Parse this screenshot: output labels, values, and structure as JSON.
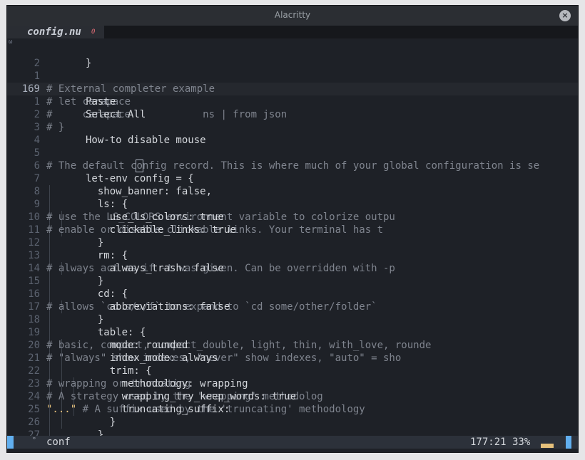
{
  "window": {
    "title": "Alacritty",
    "close_glyph": "×"
  },
  "tab": {
    "name": "config.nu",
    "badge": "0"
  },
  "gutter_marker": "ω",
  "lines": [
    {
      "n": "2",
      "parts": [
        {
          "t": "}",
          "c": "code"
        }
      ]
    },
    {
      "n": "1",
      "parts": []
    },
    {
      "n": "169",
      "current": true,
      "parts": [
        {
          "t": "# External completer example",
          "c": "comment"
        }
      ]
    },
    {
      "n": "1",
      "parts": [
        {
          "t": "# let carapace ",
          "c": "comment"
        },
        {
          "t": "Paste",
          "c": "code"
        }
      ]
    },
    {
      "n": "2",
      "parts": [
        {
          "t": "#     carapace ",
          "c": "comment"
        },
        {
          "t": "Select All",
          "c": "code"
        },
        {
          "t": "           ns | from json",
          "c": "comment"
        }
      ]
    },
    {
      "n": "3",
      "parts": [
        {
          "t": "# }",
          "c": "comment"
        }
      ]
    },
    {
      "n": "4",
      "parts": [
        {
          "t": "               ",
          "c": "code"
        },
        {
          "t": "How-to disable mouse",
          "c": "code"
        }
      ]
    },
    {
      "n": "5",
      "parts": []
    },
    {
      "n": "6",
      "parts": [
        {
          "t": "# The default c",
          "c": "comment"
        },
        {
          "t": "o",
          "c": "comment cursor"
        },
        {
          "t": "nfig record. This is where much of your global configuration is se",
          "c": "comment"
        }
      ]
    },
    {
      "n": "7",
      "parts": [
        {
          "t": "let-env config = {",
          "c": "code"
        }
      ]
    },
    {
      "n": "8",
      "guides": [
        1
      ],
      "parts": [
        {
          "t": "  show_banner: false,",
          "c": "code"
        }
      ]
    },
    {
      "n": "9",
      "guides": [
        1
      ],
      "parts": [
        {
          "t": "  ls: {",
          "c": "code"
        }
      ]
    },
    {
      "n": "10",
      "guides": [
        1,
        2
      ],
      "parts": [
        {
          "t": "    use_ls_colors: true ",
          "c": "code"
        },
        {
          "t": "# use the LS_COLORS environment variable to colorize outpu",
          "c": "comment"
        }
      ]
    },
    {
      "n": "11",
      "guides": [
        1,
        2
      ],
      "parts": [
        {
          "t": "    clickable_links: true ",
          "c": "code"
        },
        {
          "t": "# enable or disable clickable links. Your terminal has t",
          "c": "comment"
        }
      ]
    },
    {
      "n": "12",
      "guides": [
        1
      ],
      "parts": [
        {
          "t": "  }",
          "c": "code"
        }
      ]
    },
    {
      "n": "13",
      "guides": [
        1
      ],
      "parts": [
        {
          "t": "  rm: {",
          "c": "code"
        }
      ]
    },
    {
      "n": "14",
      "guides": [
        1,
        2
      ],
      "parts": [
        {
          "t": "    always_trash: false ",
          "c": "code"
        },
        {
          "t": "# always act as if -t was given. Can be overridden with -p",
          "c": "comment"
        }
      ]
    },
    {
      "n": "15",
      "guides": [
        1
      ],
      "parts": [
        {
          "t": "  }",
          "c": "code"
        }
      ]
    },
    {
      "n": "16",
      "guides": [
        1
      ],
      "parts": [
        {
          "t": "  cd: {",
          "c": "code"
        }
      ]
    },
    {
      "n": "17",
      "guides": [
        1,
        2
      ],
      "parts": [
        {
          "t": "    abbreviations: false ",
          "c": "code"
        },
        {
          "t": "# allows `cd s/o/f` to expand to `cd some/other/folder`",
          "c": "comment"
        }
      ]
    },
    {
      "n": "18",
      "guides": [
        1
      ],
      "parts": [
        {
          "t": "  }",
          "c": "code"
        }
      ]
    },
    {
      "n": "19",
      "guides": [
        1
      ],
      "parts": [
        {
          "t": "  table: {",
          "c": "code"
        }
      ]
    },
    {
      "n": "20",
      "guides": [
        1,
        2
      ],
      "parts": [
        {
          "t": "    mode: rounded ",
          "c": "code"
        },
        {
          "t": "# basic, compact, compact_double, light, thin, with_love, rounde",
          "c": "comment"
        }
      ]
    },
    {
      "n": "21",
      "guides": [
        1,
        2
      ],
      "parts": [
        {
          "t": "    index_mode: always ",
          "c": "code"
        },
        {
          "t": "# \"always\" show indexes, \"never\" show indexes, \"auto\" = sho",
          "c": "comment"
        }
      ]
    },
    {
      "n": "22",
      "guides": [
        1,
        2
      ],
      "parts": [
        {
          "t": "    trim: {",
          "c": "code"
        }
      ]
    },
    {
      "n": "23",
      "guides": [
        1,
        2,
        3
      ],
      "parts": [
        {
          "t": "      methodology: wrapping ",
          "c": "code"
        },
        {
          "t": "# wrapping or truncating",
          "c": "comment"
        }
      ]
    },
    {
      "n": "24",
      "guides": [
        1,
        2,
        3
      ],
      "parts": [
        {
          "t": "      wrapping_try_keep_words: true ",
          "c": "code"
        },
        {
          "t": "# A strategy used by the 'wrapping' methodolog",
          "c": "comment"
        }
      ]
    },
    {
      "n": "25",
      "guides": [
        1,
        2,
        3
      ],
      "parts": [
        {
          "t": "      truncating_suffix: ",
          "c": "code"
        },
        {
          "t": "\"...\"",
          "c": "str"
        },
        {
          "t": " # A suffix used by the 'truncating' methodology",
          "c": "comment"
        }
      ]
    },
    {
      "n": "26",
      "guides": [
        1,
        2
      ],
      "parts": [
        {
          "t": "    }",
          "c": "code"
        }
      ]
    },
    {
      "n": "27",
      "guides": [
        1
      ],
      "parts": [
        {
          "t": "  }",
          "c": "code"
        }
      ]
    }
  ],
  "status": {
    "tiny": "∞",
    "file": "conf",
    "position": "177:21 33%"
  },
  "colors": {
    "accent": "#61afef",
    "background": "#1e2127",
    "comment": "#7f848e",
    "string": "#e5c07b"
  }
}
